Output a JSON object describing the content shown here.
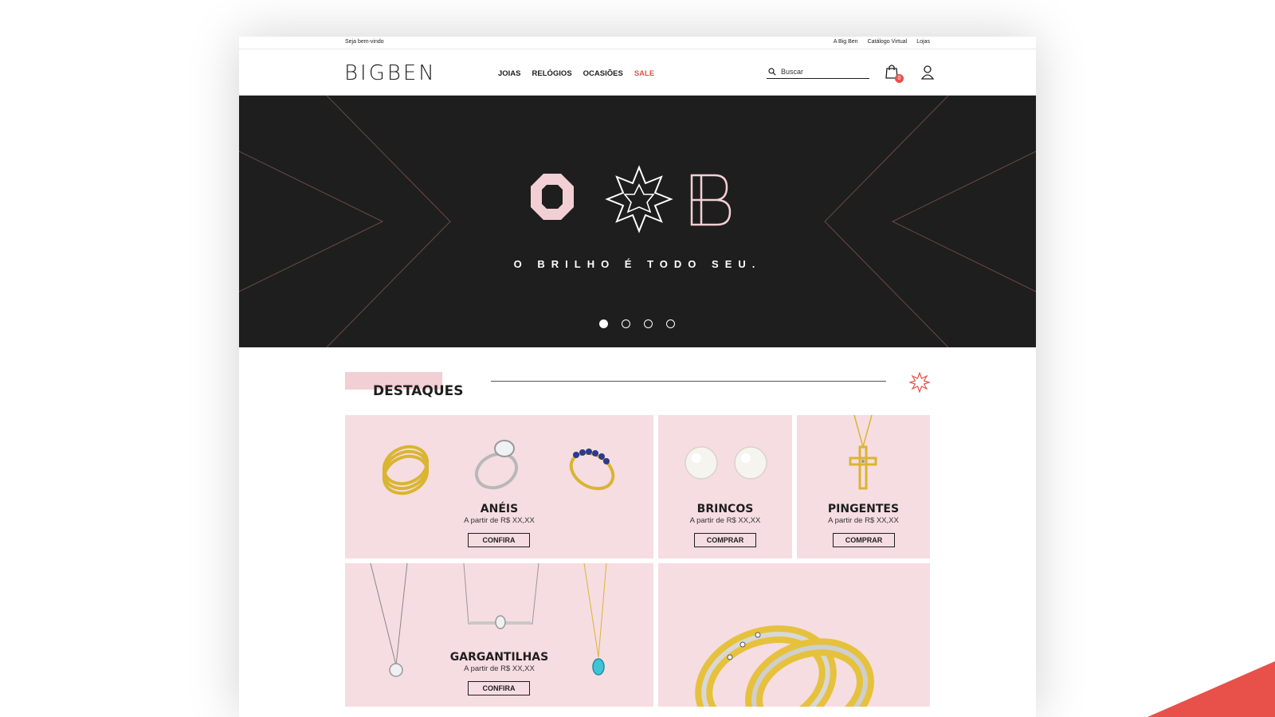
{
  "topbar": {
    "welcome": "Seja bem-vindo",
    "links": [
      "A Big Ben",
      "Catálogo Virtual",
      "Lojas"
    ]
  },
  "header": {
    "logo": "BIGBEN",
    "nav": [
      "JOIAS",
      "RELÓGIOS",
      "OCASIÕES",
      "SALE"
    ],
    "search_placeholder": "Buscar",
    "cart_count": "0"
  },
  "hero": {
    "tagline": "O BRILHO É TODO SEU.",
    "slides": 4,
    "active_slide": 1
  },
  "section": {
    "title": "DESTAQUES"
  },
  "cards": [
    {
      "name": "ANÉIS",
      "price": "A partir de R$ XX,XX",
      "button": "CONFIRA"
    },
    {
      "name": "BRINCOS",
      "price": "A partir de R$ XX,XX",
      "button": "COMPRAR"
    },
    {
      "name": "PINGENTES",
      "price": "A partir de R$ XX,XX",
      "button": "COMPRAR"
    },
    {
      "name": "GARGANTILHAS",
      "price": "A partir de R$ XX,XX",
      "button": "CONFIRA"
    }
  ],
  "colors": {
    "accent": "#e8504a",
    "pink": "#f6dde2",
    "dark": "#1e1e1e",
    "gold": "#e6c13c"
  }
}
